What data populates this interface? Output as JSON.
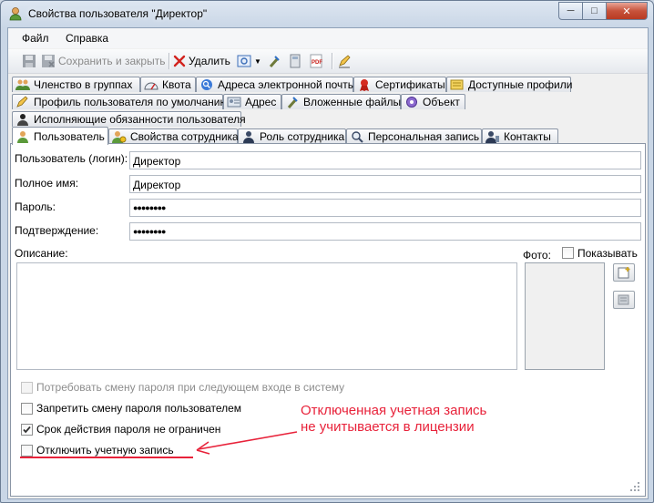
{
  "window": {
    "title": "Свойства пользователя \"Директор\"",
    "controls": {
      "minimize": "─",
      "maximize": "□",
      "close": "✕"
    }
  },
  "menu": {
    "file": "Файл",
    "help": "Справка"
  },
  "toolbar": {
    "save_close": "Сохранить и закрыть",
    "delete": "Удалить"
  },
  "tabs": {
    "row1": [
      "Членство в группах",
      "Квота",
      "Адреса электронной почты",
      "Сертификаты",
      "Доступные профили"
    ],
    "row2": [
      "Профиль пользователя по умолчанию",
      "Адрес",
      "Вложенные файлы",
      "Объект"
    ],
    "row3": [
      "Исполняющие обязанности пользователя"
    ],
    "row4": [
      "Пользователь",
      "Свойства сотрудника",
      "Роль сотрудника",
      "Персональная запись",
      "Контакты"
    ],
    "active": "Пользователь"
  },
  "form": {
    "login_label": "Пользователь (логин):",
    "login_value": "Директор",
    "fullname_label": "Полное имя:",
    "fullname_value": "Директор",
    "password_label": "Пароль:",
    "password_value": "●●●●●●●●",
    "confirm_label": "Подтверждение:",
    "confirm_value": "●●●●●●●●",
    "description_label": "Описание:",
    "photo_label": "Фото:",
    "show_label": "Показывать"
  },
  "checkboxes": {
    "require_change": {
      "label": "Потребовать смену пароля при следующем входе в систему",
      "checked": false,
      "enabled": false
    },
    "forbid_change": {
      "label": "Запретить смену пароля пользователем",
      "checked": false,
      "enabled": true
    },
    "no_expiry": {
      "label": "Срок действия пароля не ограничен",
      "checked": true,
      "enabled": true
    },
    "disable_account": {
      "label": "Отключить учетную запись",
      "checked": false,
      "enabled": true
    }
  },
  "annotation": {
    "line1": "Отключенная учетная запись",
    "line2": "не учитывается в лицензии",
    "color": "#e8223a"
  },
  "colors": {
    "accent": "#2a6fc9",
    "panel": "#ffffff",
    "chrome": "#f0f0f0"
  }
}
